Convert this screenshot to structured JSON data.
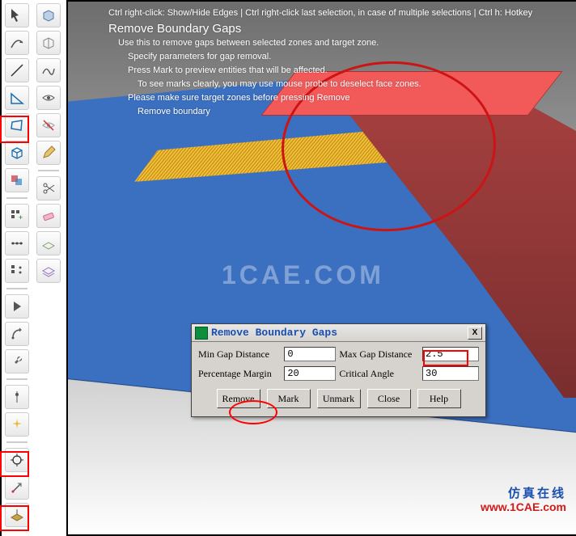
{
  "toolbar_left": {
    "items": [
      "select",
      "cube",
      "line",
      "curve",
      "triangle",
      "eye",
      "quad",
      "eye-slash",
      "box",
      "pencil",
      "faces",
      "grid-add",
      "scissors",
      "align",
      "eraser",
      "plane",
      "play",
      "pivot",
      "wrench",
      "spark",
      "target",
      "arrow-dot",
      "flatten"
    ]
  },
  "viewport": {
    "hint_line": "Ctrl right-click: Show/Hide Edges | Ctrl right-click last selection, in case of multiple selections | Ctrl h: Hotkey",
    "title": "Remove Boundary Gaps",
    "help_lines": [
      "Use this to remove gaps between selected zones and target zone.",
      "Specify parameters for gap removal.",
      "Press Mark to preview entities that will be affected.",
      "To see marks clearly, you may use mouse probe to deselect face zones.",
      "Please make sure target zones before pressing Remove",
      "Remove boundary"
    ],
    "watermark": "1CAE.COM",
    "watermark_cn": "仿真在线",
    "watermark_url": "www.1CAE.com"
  },
  "dialog": {
    "title": "Remove Boundary Gaps",
    "fields": {
      "min_gap_label": "Min Gap Distance",
      "min_gap_value": "0",
      "max_gap_label": "Max Gap Distance",
      "max_gap_value": "2.5",
      "percent_label": "Percentage Margin",
      "percent_value": "20",
      "angle_label": "Critical Angle",
      "angle_value": "30"
    },
    "buttons": {
      "remove": "Remove",
      "mark": "Mark",
      "unmark": "Unmark",
      "close": "Close",
      "help": "Help"
    },
    "close_x": "X"
  }
}
